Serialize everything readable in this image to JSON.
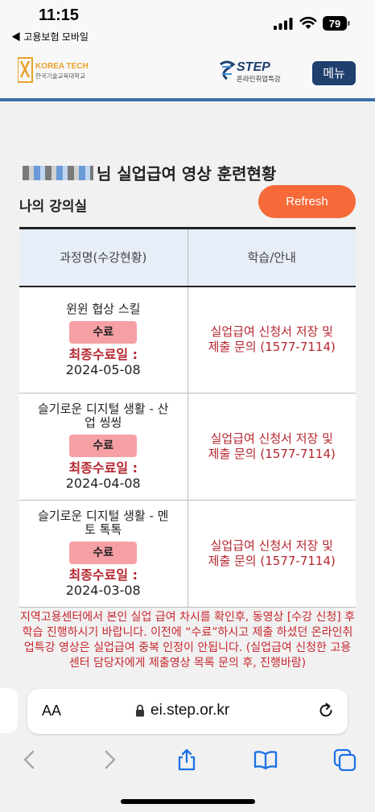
{
  "status_bar": {
    "time": "11:15",
    "back_app": "◀ 고용보험 모바일",
    "battery": "79"
  },
  "header": {
    "logo_korea_tech_line1": "KOREA TECH",
    "logo_korea_tech_line2": "한국기술교육대학교",
    "logo_step_line1": "STEP",
    "logo_step_line2": "온라인취업특강",
    "menu_label": "메뉴"
  },
  "main": {
    "page_title_suffix": "님 실업급여 영상 훈련현황",
    "section_title": "나의 강의실",
    "refresh_label": "Refresh",
    "table": {
      "headers": [
        "과정명(수강현황)",
        "학습/안내"
      ],
      "rows": [
        {
          "course_name": "윈윈 협상 스킬",
          "status": "수료",
          "final_label": "최종수료일 :",
          "final_date": "2024-05-08",
          "inquiry": "실업급여 신청서 저장 및 제출 문의 (1577-7114)"
        },
        {
          "course_name": "슬기로운 디지털 생활 - 산업 씽씽",
          "status": "수료",
          "final_label": "최종수료일 :",
          "final_date": "2024-04-08",
          "inquiry": "실업급여 신청서 저장 및 제출 문의 (1577-7114)"
        },
        {
          "course_name": "슬기로운 디지털 생활 - 멘토 톡톡",
          "status": "수료",
          "final_label": "최종수료일 :",
          "final_date": "2024-03-08",
          "inquiry": "실업급여 신청서 저장 및 제출 문의 (1577-7114)"
        }
      ]
    },
    "notice": "지역고용센터에서 본인 실업 급여 차시를 확인후, 동영상 [수강 신청] 후 학습 진행하시기 바랍니다. 이전에 “수료”하시고 제출 하셨던 온라인취업특강 영상은 실업급여 중복 인정이 안됩니다. (실업급여 신청한 고용센터 담당자에게 제출영상 목록 문의 후, 진행바람)"
  },
  "browser": {
    "aa_label": "AA",
    "url": "ei.step.or.kr"
  },
  "colors": {
    "accent_blue": "#3b6fa8",
    "menu_bg": "#1f3f6d",
    "refresh_bg": "#f56a38",
    "badge_bg": "#f6a0a5",
    "alert_red": "#b5262e"
  }
}
